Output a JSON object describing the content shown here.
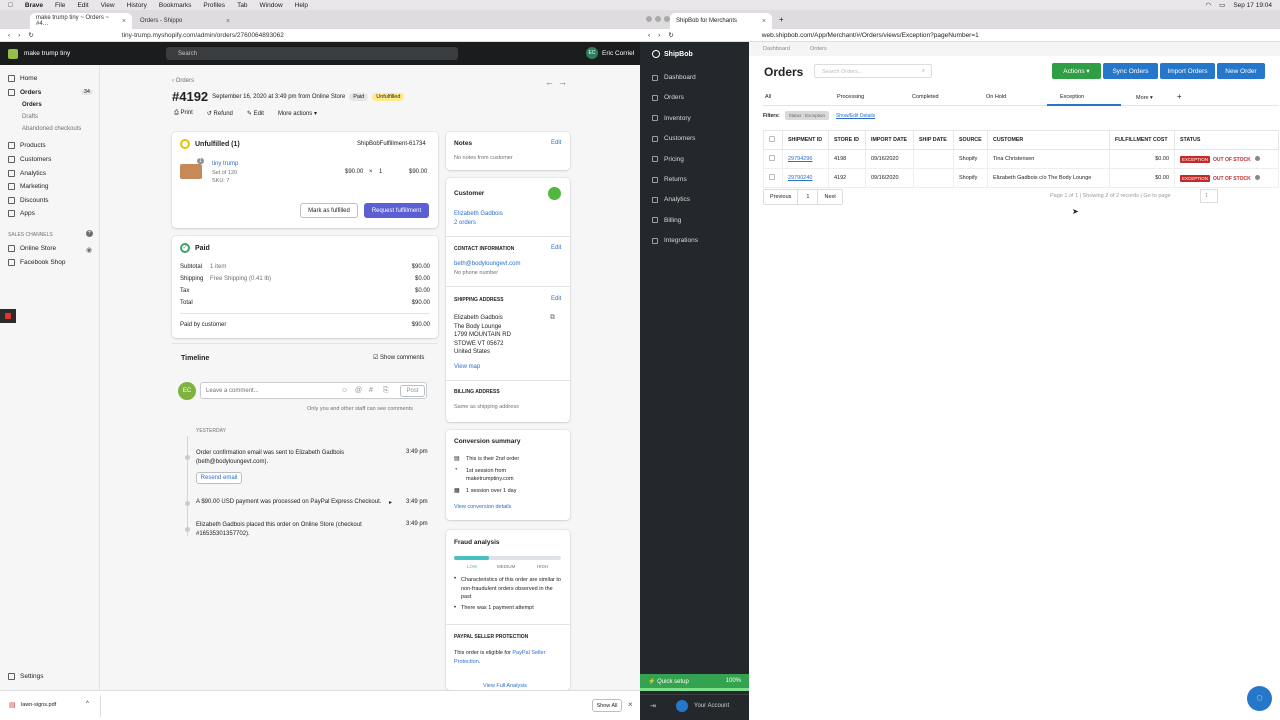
{
  "menubar": {
    "app": "Brave",
    "items": [
      "File",
      "Edit",
      "View",
      "History",
      "Bookmarks",
      "Profiles",
      "Tab",
      "Window",
      "Help"
    ],
    "clock": "Sep 17  19:04"
  },
  "left_browser": {
    "tabs": [
      {
        "title": "make trump tiny ~ Orders ~ #4…"
      },
      {
        "title": "Orders - Shippo"
      }
    ],
    "url": "tiny-trump.myshopify.com/admin/orders/2760064893062"
  },
  "shopify": {
    "store": "make trump tiny",
    "search_placeholder": "Search",
    "user_initials": "EC",
    "user_name": "Eric Corriel",
    "nav": {
      "home": "Home",
      "orders": "Orders",
      "orders_count": "34",
      "sub_orders": "Orders",
      "sub_drafts": "Drafts",
      "sub_abandoned": "Abandoned checkouts",
      "products": "Products",
      "customers": "Customers",
      "analytics": "Analytics",
      "marketing": "Marketing",
      "discounts": "Discounts",
      "apps": "Apps",
      "sales_channels": "SALES CHANNELS",
      "online_store": "Online Store",
      "facebook_shop": "Facebook Shop",
      "settings": "Settings"
    },
    "breadcrumb": "Orders",
    "order": {
      "number": "#4192",
      "date": "September 16, 2020 at 3:49 pm from Online Store",
      "paid_badge": "Paid",
      "unfulfilled_badge": "Unfulfilled",
      "print": "Print",
      "refund": "Refund",
      "edit": "Edit",
      "more_actions": "More actions"
    },
    "unfulfilled": {
      "title": "Unfulfilled (1)",
      "ref": "ShipBobFulfillment-61734",
      "item_name": "tiny trump",
      "item_variant": "Set of 120",
      "item_sku": "SKU: 7",
      "item_qty_badge": "1",
      "price": "$90.00",
      "x": "×",
      "qty": "1",
      "total": "$90.00",
      "mark_fulfilled": "Mark as fulfilled",
      "request_fulfillment": "Request fulfillment"
    },
    "paid": {
      "title": "Paid",
      "rows": [
        {
          "label": "Subtotal",
          "mid": "1 item",
          "value": "$90.00"
        },
        {
          "label": "Shipping",
          "mid": "Free Shipping (0.41 lb)",
          "value": "$0.00"
        },
        {
          "label": "Tax",
          "mid": "",
          "value": "$0.00"
        },
        {
          "label": "Total",
          "mid": "",
          "value": "$90.00"
        }
      ],
      "paid_by_label": "Paid by customer",
      "paid_by_value": "$90.00"
    },
    "timeline": {
      "title": "Timeline",
      "show_comments": "Show comments",
      "avatar": "EC",
      "comment_placeholder": "Leave a comment...",
      "post": "Post",
      "visibility_note": "Only you and other staff can see comments",
      "day": "YESTERDAY",
      "events": [
        {
          "text": "Order confirmation email was sent to Elizabeth Gadbois (beth@bodyloungevt.com).",
          "time": "3:49 pm"
        },
        {
          "text": "A $90.00 USD payment was processed on PayPal Express Checkout.",
          "time": "3:49 pm"
        },
        {
          "text": "Elizabeth Gadbois placed this order on Online Store (checkout #16535301357702).",
          "time": "3:49 pm"
        }
      ],
      "resend": "Resend email"
    },
    "notes": {
      "title": "Notes",
      "edit": "Edit",
      "empty": "No notes from customer"
    },
    "customer": {
      "title": "Customer",
      "name": "Elizabeth Gadbois",
      "orders": "2 orders",
      "contact_title": "CONTACT INFORMATION",
      "contact_edit": "Edit",
      "email": "beth@bodyloungevt.com",
      "phone": "No phone number",
      "shipping_title": "SHIPPING ADDRESS",
      "shipping_edit": "Edit",
      "address": [
        "Elizabeth Gadbois",
        "The Body Lounge",
        "1799 MOUNTAIN RD",
        "STOWE VT 05672",
        "United States"
      ],
      "view_map": "View map",
      "billing_title": "BILLING ADDRESS",
      "billing_same": "Same as shipping address"
    },
    "conversion": {
      "title": "Conversion summary",
      "line1": "This is their 2nd order",
      "line2a": "1st session from",
      "line2b": "maketrumptiny.com",
      "line3": "1 session over 1 day",
      "link": "View conversion details"
    },
    "fraud": {
      "title": "Fraud analysis",
      "level": 0.33,
      "labels": [
        "LOW",
        "MEDIUM",
        "HIGH"
      ],
      "bullet1": "Characteristics of this order are similar to non-fraudulent orders observed in the past",
      "bullet2": "There was 1 payment attempt",
      "paypal_title": "PAYPAL SELLER PROTECTION",
      "paypal_text": "This order is eligible for ",
      "paypal_link": "PayPal Seller Protection",
      "paypal_end": ".",
      "full_link": "View Full Analysis"
    },
    "download": {
      "file": "lawn-signs.pdf",
      "show_all": "Show All"
    }
  },
  "shipbob": {
    "tab_title": "ShipBob for Merchants",
    "url": "web.shipbob.com/App/Merchant/#/Orders/views/Exception?pageNumber=1",
    "logo": "ShipBob",
    "nav": [
      "Dashboard",
      "Orders",
      "Inventory",
      "Customers",
      "Pricing",
      "Returns",
      "Analytics",
      "Billing",
      "Integrations"
    ],
    "quick_setup": "Quick setup",
    "quick_setup_pct": "100%",
    "quick_setup_progress": 1.0,
    "account": "Your Account",
    "breadcrumb": [
      "Dashboard",
      "Orders"
    ],
    "title": "Orders",
    "search_placeholder": "Search Orders...",
    "buttons": {
      "actions": "Actions",
      "sync": "Sync Orders",
      "import": "Import Orders",
      "new": "New Order"
    },
    "tabs": [
      "All",
      "Processing",
      "Completed",
      "On Hold",
      "Exception",
      "More"
    ],
    "filters_label": "Filters:",
    "filter_chip": "Status : Exception",
    "filter_link": "Show/Edit Details",
    "columns": [
      "SHIPMENT ID",
      "STORE ID",
      "IMPORT DATE",
      "SHIP DATE",
      "SOURCE",
      "CUSTOMER",
      "FULFILLMENT COST",
      "STATUS"
    ],
    "rows": [
      {
        "shipment_id": "29794296",
        "store_id": "4198",
        "import_date": "09/16/2020",
        "ship_date": "",
        "source": "Shopify",
        "customer": "Tina Christensen",
        "cost": "$0.00",
        "badge": "EXCEPTION",
        "status": "OUT OF STOCK"
      },
      {
        "shipment_id": "29790240",
        "store_id": "4192",
        "import_date": "09/16/2020",
        "ship_date": "",
        "source": "Shopify",
        "customer": "Elizabeth Gadbois c/o The Body Lounge",
        "cost": "$0.00",
        "badge": "EXCEPTION",
        "status": "OUT OF STOCK"
      }
    ],
    "pager": {
      "prev": "Previous",
      "page": "1",
      "next": "Next",
      "summary": "Page 1 of 1 | Showing 2 of 2 records | Go to page",
      "goto": "1"
    }
  }
}
